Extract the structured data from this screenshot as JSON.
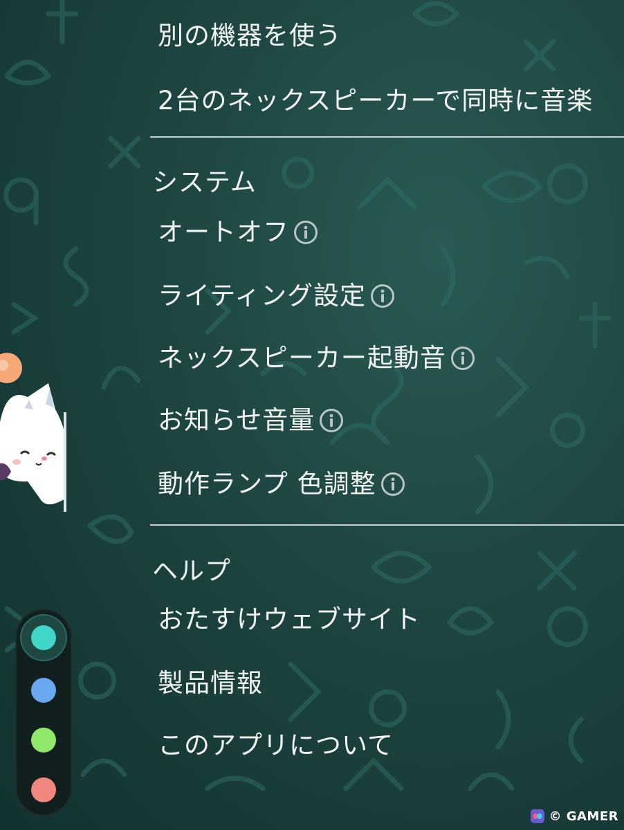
{
  "menu": {
    "top_items": [
      {
        "label": "別の機器を使う"
      },
      {
        "label": "2台のネックスピーカーで同時に音楽"
      }
    ],
    "sections": [
      {
        "title": "システム",
        "items": [
          {
            "label": "オートオフ",
            "info": true
          },
          {
            "label": "ライティング設定",
            "info": true
          },
          {
            "label": "ネックスピーカー起動音",
            "info": true
          },
          {
            "label": "お知らせ音量",
            "info": true
          },
          {
            "label": "動作ランプ 色調整",
            "info": true
          }
        ]
      },
      {
        "title": "ヘルプ",
        "items": [
          {
            "label": "おたすけウェブサイト"
          },
          {
            "label": "製品情報"
          },
          {
            "label": "このアプリについて"
          }
        ]
      }
    ]
  },
  "color_picker": {
    "swatches": [
      {
        "color": "#3fd6c9",
        "selected": true
      },
      {
        "color": "#6aa8f2",
        "selected": false
      },
      {
        "color": "#8fe86a",
        "selected": false
      },
      {
        "color": "#f0877f",
        "selected": false
      }
    ]
  },
  "icons": {
    "info": "info-circle-icon",
    "mascot": "moogle-icon",
    "watermark_logo": "gamer-logo-icon"
  },
  "watermark": {
    "text": "© GAMER"
  },
  "colors": {
    "background": "#1d4541",
    "text": "#f4f6f5",
    "divider": "#c9d3d1",
    "info_icon": "#b9c6c4"
  }
}
